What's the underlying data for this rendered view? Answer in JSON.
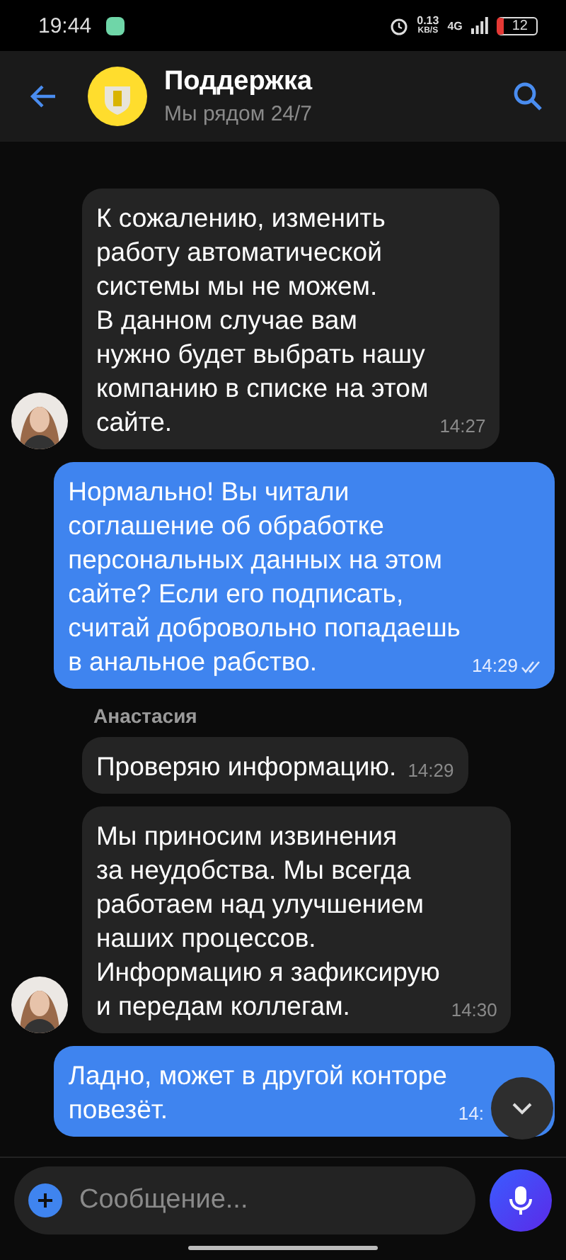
{
  "status_bar": {
    "time": "19:44",
    "speed": "0.13",
    "speed_unit": "KB/S",
    "network": "4G",
    "battery": "12"
  },
  "header": {
    "title": "Поддержка",
    "subtitle": "Мы рядом 24/7"
  },
  "messages": [
    {
      "kind": "incoming",
      "text": "К сожалению, изменить\nработу автоматической\nсистемы мы не можем.\nВ данном случае вам\nнужно будет выбрать нашу\nкомпанию в списке на этом\nсайте.",
      "time": "14:27",
      "avatar": true
    },
    {
      "kind": "outgoing",
      "text": "Нормально! Вы читали\nсоглашение об обработке\nперсональных данных на этом\nсайте? Если его подписать,\nсчитай добровольно попадаешь\nв анальное рабство.",
      "time": "14:29",
      "read": true
    },
    {
      "kind": "sender",
      "text": "Анастасия"
    },
    {
      "kind": "incoming",
      "text": "Проверяю информацию.",
      "time": "14:29",
      "avatar": false
    },
    {
      "kind": "incoming",
      "text": "Мы приносим извинения\nза неудобства. Мы всегда\nработаем над улучшением\nнаших процессов.\nИнформацию я зафиксирую\nи передам коллегам.",
      "time": "14:30",
      "avatar": true
    },
    {
      "kind": "outgoing",
      "text": "Ладно, может в другой конторе\nповезёт.",
      "time": "14:",
      "read": false
    }
  ],
  "composer": {
    "placeholder": "Сообщение..."
  }
}
